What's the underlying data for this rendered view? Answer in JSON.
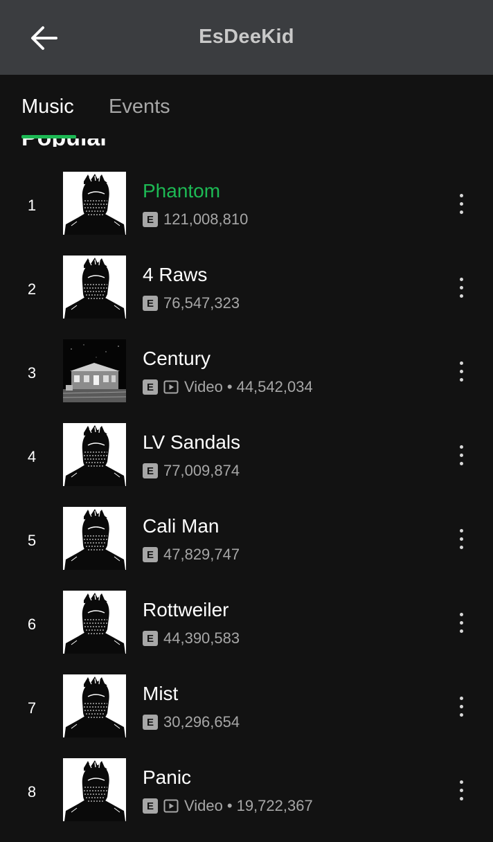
{
  "header": {
    "title": "EsDeeKid",
    "back_icon": "arrow-left-icon"
  },
  "tabs": [
    {
      "label": "Music",
      "selected": true
    },
    {
      "label": "Events",
      "selected": false
    }
  ],
  "section": {
    "heading": "Popular"
  },
  "colors": {
    "accent": "#1db954",
    "background": "#121212",
    "topbar": "#3b3d40",
    "secondary_text": "#a7a7a7"
  },
  "tracks": [
    {
      "rank": "1",
      "title": "Phantom",
      "explicit": "E",
      "video_label": "",
      "separator": "",
      "plays": "121,008,810",
      "playing": true,
      "cover": "masked-portrait"
    },
    {
      "rank": "2",
      "title": "4 Raws",
      "explicit": "E",
      "video_label": "",
      "separator": "",
      "plays": "76,547,323",
      "playing": false,
      "cover": "masked-portrait"
    },
    {
      "rank": "3",
      "title": "Century",
      "explicit": "E",
      "video_label": "Video",
      "separator": "•",
      "plays": "44,542,034",
      "playing": false,
      "cover": "house-night"
    },
    {
      "rank": "4",
      "title": "LV Sandals",
      "explicit": "E",
      "video_label": "",
      "separator": "",
      "plays": "77,009,874",
      "playing": false,
      "cover": "masked-portrait"
    },
    {
      "rank": "5",
      "title": "Cali Man",
      "explicit": "E",
      "video_label": "",
      "separator": "",
      "plays": "47,829,747",
      "playing": false,
      "cover": "masked-portrait"
    },
    {
      "rank": "6",
      "title": "Rottweiler",
      "explicit": "E",
      "video_label": "",
      "separator": "",
      "plays": "44,390,583",
      "playing": false,
      "cover": "masked-portrait"
    },
    {
      "rank": "7",
      "title": "Mist",
      "explicit": "E",
      "video_label": "",
      "separator": "",
      "plays": "30,296,654",
      "playing": false,
      "cover": "masked-portrait"
    },
    {
      "rank": "8",
      "title": "Panic",
      "explicit": "E",
      "video_label": "Video",
      "separator": "•",
      "plays": "19,722,367",
      "playing": false,
      "cover": "masked-portrait"
    }
  ]
}
